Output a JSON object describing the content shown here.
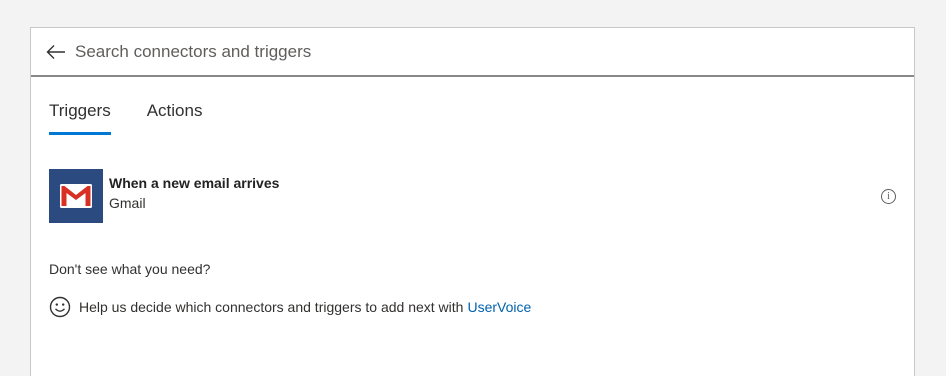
{
  "search": {
    "placeholder": "Search connectors and triggers",
    "value": "",
    "back_icon": "arrow-left-icon"
  },
  "tabs": [
    {
      "label": "Triggers",
      "active": true
    },
    {
      "label": "Actions",
      "active": false
    }
  ],
  "trigger": {
    "title": "When a new email arrives",
    "connector": "Gmail",
    "icon": "gmail-icon",
    "info_icon": "info-icon"
  },
  "footer": {
    "heading": "Don't see what you need?",
    "help_text": "Help us decide which connectors and triggers to add next with",
    "link_text": "UserVoice",
    "icon": "smiley-icon"
  },
  "colors": {
    "accent": "#0078d4",
    "link": "#0062ad",
    "gmail_tile": "#2b4a7f",
    "gmail_red": "#d93025"
  }
}
